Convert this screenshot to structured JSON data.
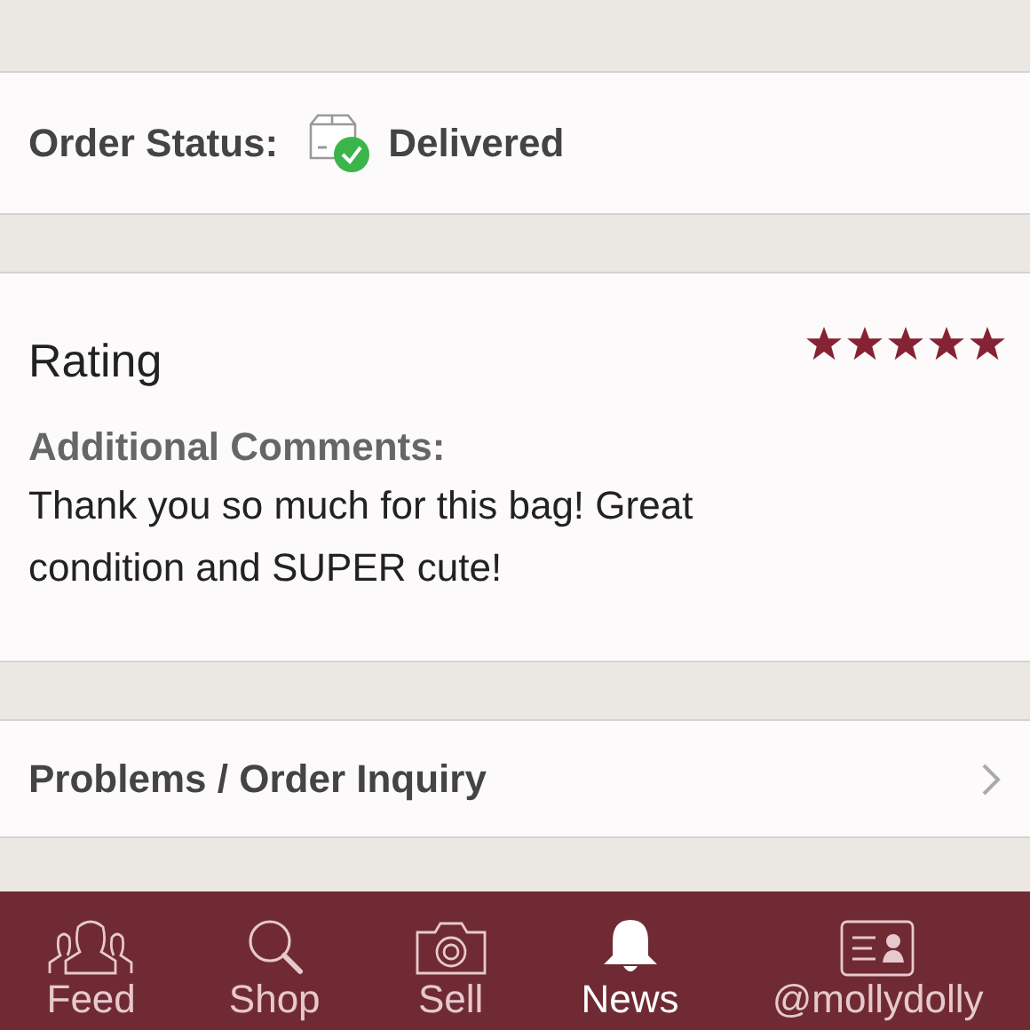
{
  "order_status": {
    "label": "Order Status:",
    "value": "Delivered"
  },
  "rating": {
    "title": "Rating",
    "stars": 5,
    "comments_label": "Additional Comments:",
    "comments": "Thank you so much for this bag! Great condition and SUPER cute!"
  },
  "problems": {
    "label": "Problems / Order Inquiry"
  },
  "tab_bar": [
    {
      "label": "Feed",
      "kind": "feed",
      "selected": false
    },
    {
      "label": "Shop",
      "kind": "shop",
      "selected": false
    },
    {
      "label": "Sell",
      "kind": "sell",
      "selected": false
    },
    {
      "label": "News",
      "kind": "news",
      "selected": true
    },
    {
      "label": "@mollydolly",
      "kind": "profile",
      "selected": false
    }
  ]
}
